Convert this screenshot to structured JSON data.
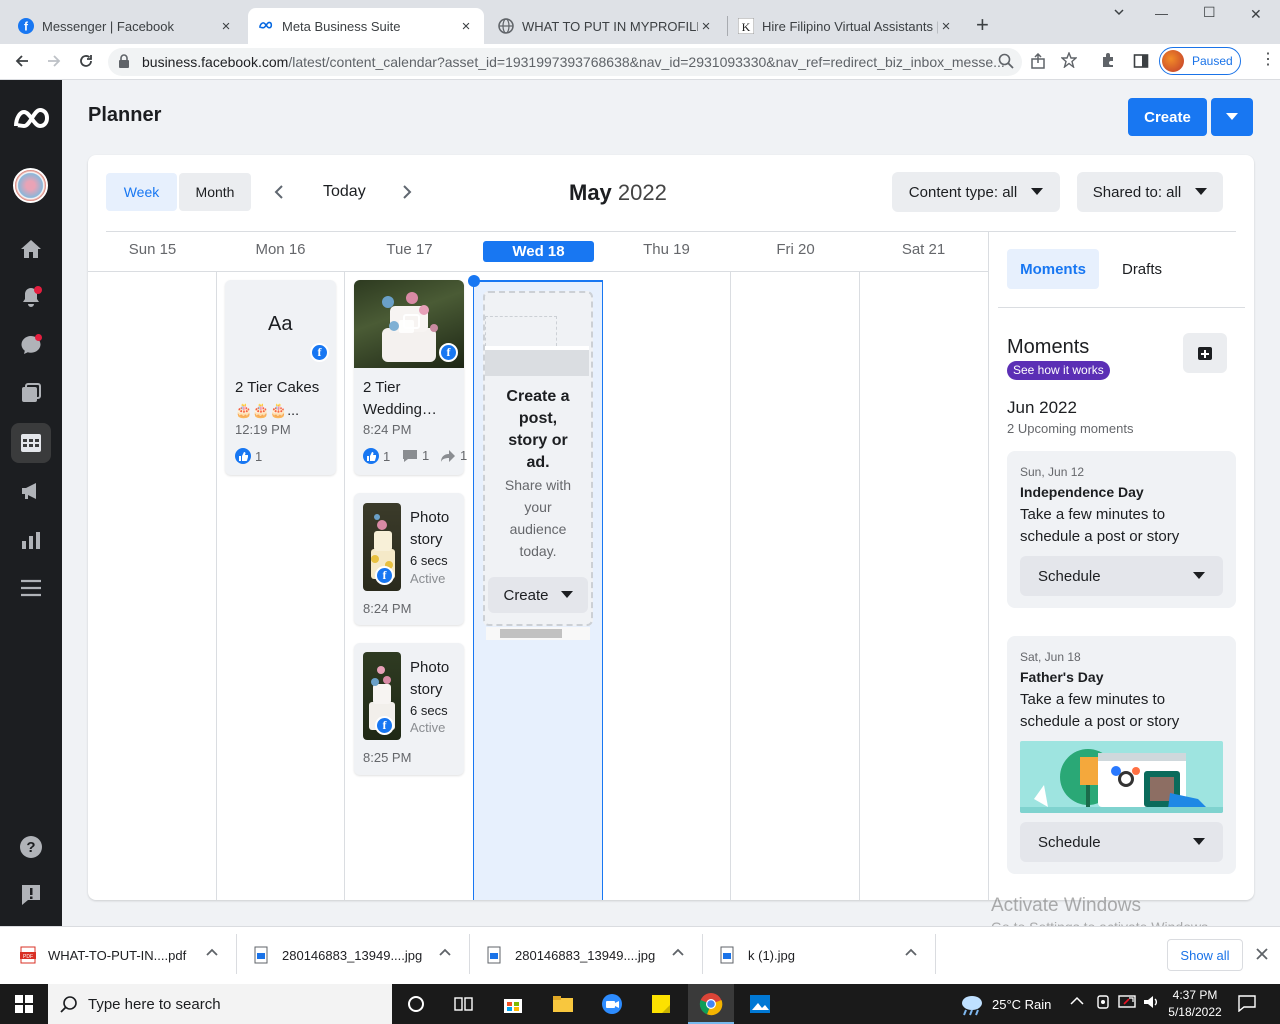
{
  "browser": {
    "tabs": [
      {
        "title": "Messenger | Facebook",
        "close": "×"
      },
      {
        "title": "Meta Business Suite",
        "close": "×"
      },
      {
        "title": "WHAT TO PUT IN MYPROFILE",
        "close": "×"
      },
      {
        "title": "Hire Filipino Virtual Assistants | F",
        "close": "×"
      }
    ],
    "new_tab": "+",
    "window_controls": {
      "minimize": "—",
      "maximize": "☐",
      "close": "✕"
    },
    "url_domain": "business.facebook.com",
    "url_path": "/latest/content_calendar?asset_id=1931997393768638&nav_id=2931093330&nav_ref=redirect_biz_inbox_messe...",
    "profile_status": "Paused"
  },
  "header": {
    "title": "Planner",
    "create_label": "Create"
  },
  "toolbar": {
    "view_week": "Week",
    "view_month": "Month",
    "today_label": "Today",
    "month_name": "May",
    "year": "2022",
    "content_filter": "Content type: all",
    "shared_filter": "Shared to: all"
  },
  "days": [
    "Sun 15",
    "Mon 16",
    "Tue 17",
    "Wed 18",
    "Thu 19",
    "Fri 20",
    "Sat 21"
  ],
  "posts": {
    "mon_text_post": {
      "preview": "Aa",
      "title": "2 Tier Cakes",
      "emoji": "🎂🎂🎂...",
      "time": "12:19 PM",
      "likes": "1"
    },
    "tue_post": {
      "title_line1": "2 Tier",
      "title_line2": "Wedding…",
      "time": "8:24 PM",
      "likes": "1",
      "comments": "1",
      "shares": "1"
    },
    "tue_story1": {
      "line1": "Photo",
      "line2": "story",
      "duration": "6 secs",
      "status": "Active",
      "time": "8:24 PM"
    },
    "tue_story2": {
      "line1": "Photo",
      "line2": "story",
      "duration": "6 secs",
      "status": "Active",
      "time": "8:25 PM"
    }
  },
  "wed_prompt": {
    "heading_lines": [
      "Create a",
      "post,",
      "story or",
      "ad."
    ],
    "sub_lines": [
      "Share with",
      "your",
      "audience",
      "today."
    ],
    "button": "Create"
  },
  "right_panel": {
    "tab_moments": "Moments",
    "tab_drafts": "Drafts",
    "heading": "Moments",
    "how_it_works": "See how it works",
    "month": "Jun 2022",
    "upcoming": "2 Upcoming moments",
    "moments": [
      {
        "date": "Sun, Jun 12",
        "name": "Independence Day",
        "desc1": "Take a few minutes to",
        "desc2": "schedule a post or story",
        "button": "Schedule"
      },
      {
        "date": "Sat, Jun 18",
        "name": "Father's Day",
        "desc1": "Take a few minutes to",
        "desc2": "schedule a post or story",
        "button": "Schedule"
      }
    ]
  },
  "watermark": {
    "line1": "Activate Windows",
    "line2": "Go to Settings to activate Windows."
  },
  "downloads": {
    "items": [
      {
        "name": "WHAT-TO-PUT-IN....pdf",
        "type": "PDF"
      },
      {
        "name": "280146883_13949....jpg"
      },
      {
        "name": "280146883_13949....jpg"
      },
      {
        "name": "k (1).jpg"
      }
    ],
    "show_all": "Show all"
  },
  "taskbar": {
    "search_placeholder": "Type here to search",
    "weather": "25°C  Rain",
    "time": "4:37 PM",
    "date": "5/18/2022"
  },
  "colors": {
    "accent": "#1877f2",
    "today_bg": "#e7f0fd",
    "purple_badge": "#5b2fb5",
    "nav_bg": "#1c1e21"
  }
}
